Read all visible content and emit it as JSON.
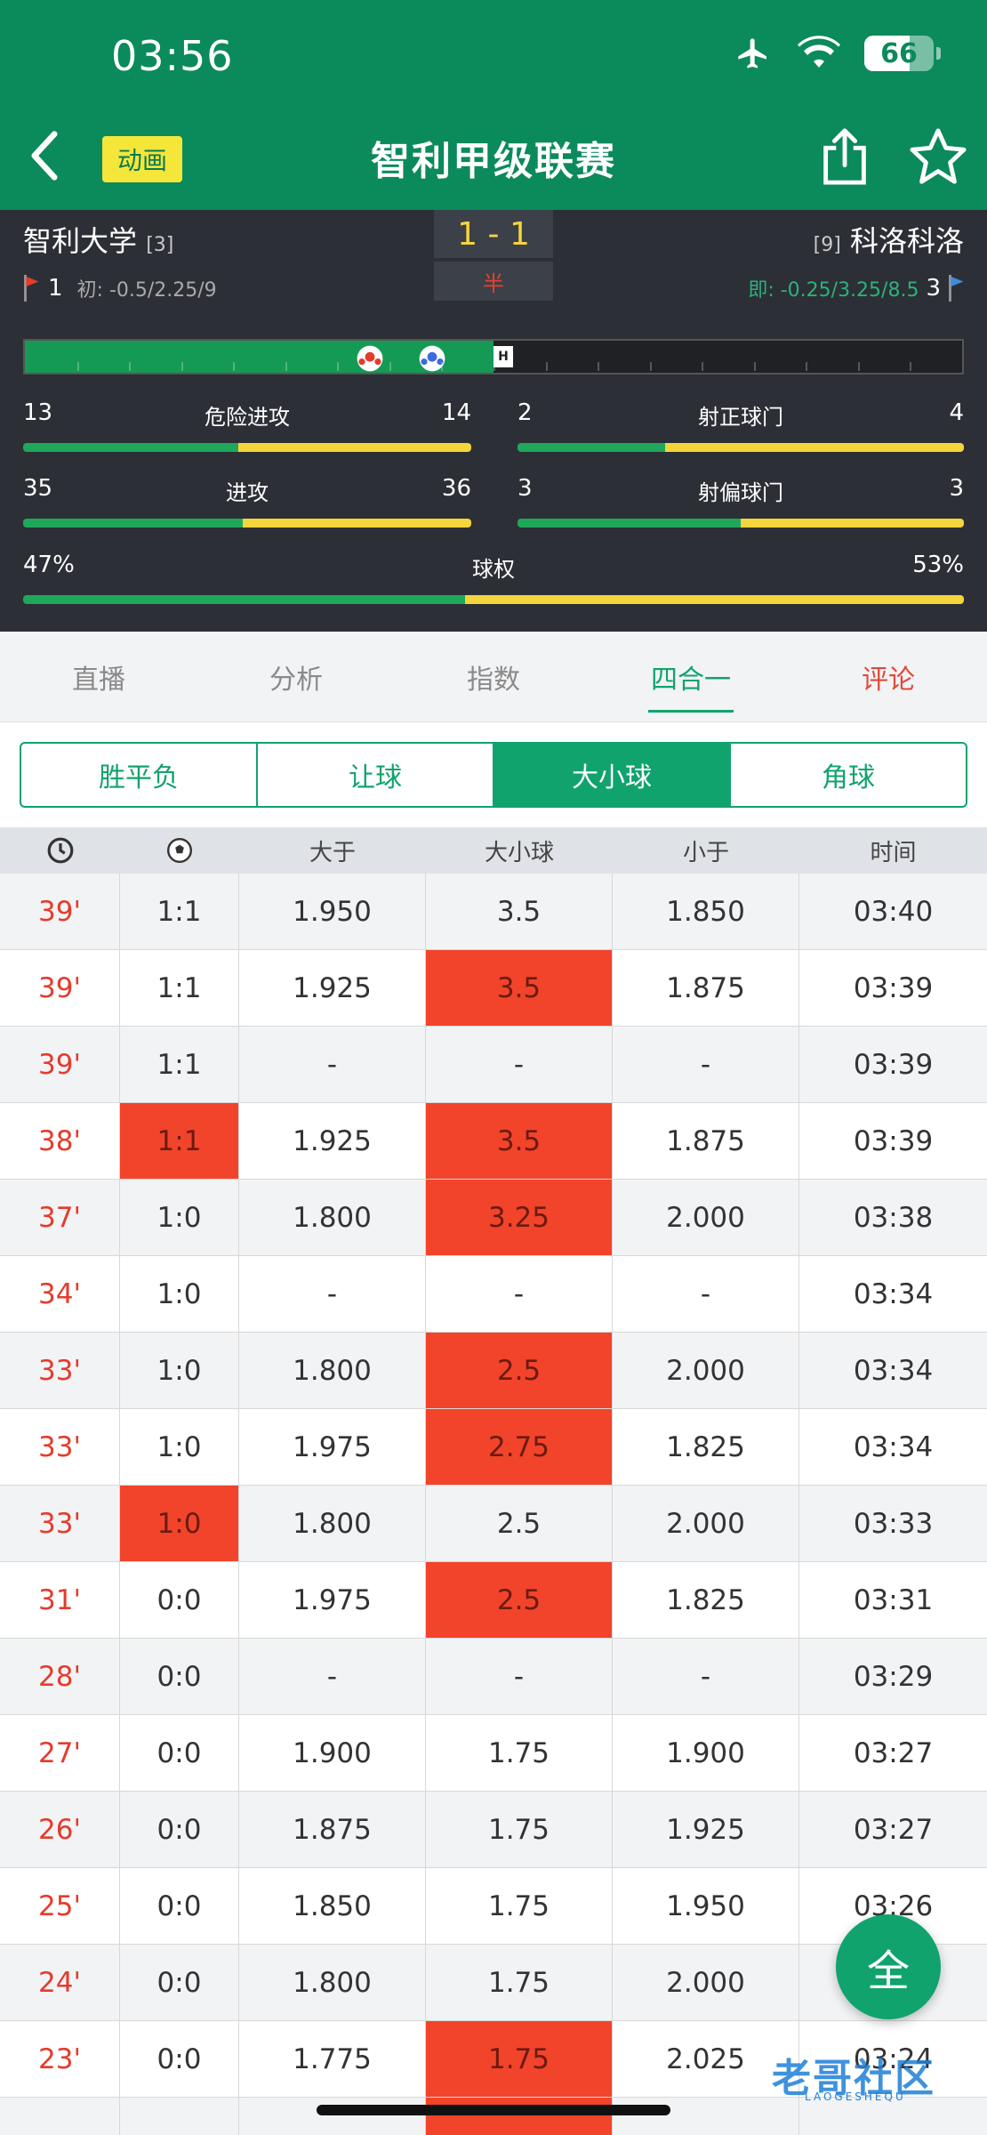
{
  "status": {
    "time": "03:56",
    "battery": "66",
    "battery_level": 0.66
  },
  "nav": {
    "title": "智利甲级联赛",
    "animation_label": "动画"
  },
  "match": {
    "home": {
      "name": "智利大学",
      "rank": "[3]",
      "corners": "1",
      "odds": "初: -0.5/2.25/9"
    },
    "away": {
      "name": "科洛科洛",
      "rank": "[9]",
      "corners": "3",
      "odds": "即: -0.25/3.25/8.5"
    },
    "score": "1 - 1",
    "period": "半",
    "timeline_progress": 0.5,
    "timeline_h_label": "H"
  },
  "stats": [
    {
      "label": "危险进攻",
      "home": "13",
      "away": "14",
      "home_share": 0.48
    },
    {
      "label": "射正球门",
      "home": "2",
      "away": "4",
      "home_share": 0.33
    },
    {
      "label": "进攻",
      "home": "35",
      "away": "36",
      "home_share": 0.49
    },
    {
      "label": "射偏球门",
      "home": "3",
      "away": "3",
      "home_share": 0.5
    },
    {
      "label": "球权",
      "home": "47%",
      "away": "53%",
      "home_share": 0.47
    }
  ],
  "tabs": [
    "直播",
    "分析",
    "指数",
    "四合一",
    "评论"
  ],
  "segments": [
    "胜平负",
    "让球",
    "大小球",
    "角球"
  ],
  "table": {
    "headers": [
      "clock-icon",
      "ball-icon",
      "大于",
      "大小球",
      "小于",
      "时间"
    ],
    "header_labels": {
      "over": "大于",
      "line": "大小球",
      "under": "小于",
      "time": "时间"
    },
    "rows": [
      {
        "min": "39'",
        "score": "1:1",
        "over": "1.950",
        "line": "3.5",
        "under": "1.850",
        "time": "03:40",
        "hl_score": false,
        "hl_line": false
      },
      {
        "min": "39'",
        "score": "1:1",
        "over": "1.925",
        "line": "3.5",
        "under": "1.875",
        "time": "03:39",
        "hl_score": false,
        "hl_line": true
      },
      {
        "min": "39'",
        "score": "1:1",
        "over": "-",
        "line": "-",
        "under": "-",
        "time": "03:39",
        "hl_score": false,
        "hl_line": false
      },
      {
        "min": "38'",
        "score": "1:1",
        "over": "1.925",
        "line": "3.5",
        "under": "1.875",
        "time": "03:39",
        "hl_score": true,
        "hl_line": true
      },
      {
        "min": "37'",
        "score": "1:0",
        "over": "1.800",
        "line": "3.25",
        "under": "2.000",
        "time": "03:38",
        "hl_score": false,
        "hl_line": true
      },
      {
        "min": "34'",
        "score": "1:0",
        "over": "-",
        "line": "-",
        "under": "-",
        "time": "03:34",
        "hl_score": false,
        "hl_line": false
      },
      {
        "min": "33'",
        "score": "1:0",
        "over": "1.800",
        "line": "2.5",
        "under": "2.000",
        "time": "03:34",
        "hl_score": false,
        "hl_line": true
      },
      {
        "min": "33'",
        "score": "1:0",
        "over": "1.975",
        "line": "2.75",
        "under": "1.825",
        "time": "03:34",
        "hl_score": false,
        "hl_line": true
      },
      {
        "min": "33'",
        "score": "1:0",
        "over": "1.800",
        "line": "2.5",
        "under": "2.000",
        "time": "03:33",
        "hl_score": true,
        "hl_line": false
      },
      {
        "min": "31'",
        "score": "0:0",
        "over": "1.975",
        "line": "2.5",
        "under": "1.825",
        "time": "03:31",
        "hl_score": false,
        "hl_line": true
      },
      {
        "min": "28'",
        "score": "0:0",
        "over": "-",
        "line": "-",
        "under": "-",
        "time": "03:29",
        "hl_score": false,
        "hl_line": false
      },
      {
        "min": "27'",
        "score": "0:0",
        "over": "1.900",
        "line": "1.75",
        "under": "1.900",
        "time": "03:27",
        "hl_score": false,
        "hl_line": false
      },
      {
        "min": "26'",
        "score": "0:0",
        "over": "1.875",
        "line": "1.75",
        "under": "1.925",
        "time": "03:27",
        "hl_score": false,
        "hl_line": false
      },
      {
        "min": "25'",
        "score": "0:0",
        "over": "1.850",
        "line": "1.75",
        "under": "1.950",
        "time": "03:26",
        "hl_score": false,
        "hl_line": false
      },
      {
        "min": "24'",
        "score": "0:0",
        "over": "1.800",
        "line": "1.75",
        "under": "2.000",
        "time": "03:25",
        "hl_score": false,
        "hl_line": false
      },
      {
        "min": "23'",
        "score": "0:0",
        "over": "1.775",
        "line": "1.75",
        "under": "2.025",
        "time": "03:24",
        "hl_score": false,
        "hl_line": true
      },
      {
        "min": "",
        "score": "",
        "over": "",
        "line": "",
        "under": "",
        "time": "",
        "hl_score": false,
        "hl_line": true
      }
    ]
  },
  "fab_label": "全",
  "watermark": {
    "text": "老哥社区",
    "sub": "LAOGESHEQU"
  },
  "colors": {
    "brand": "#0b8a5c",
    "accent": "#10a36d",
    "highlight": "#f1442a",
    "minute": "#e53b2c"
  }
}
